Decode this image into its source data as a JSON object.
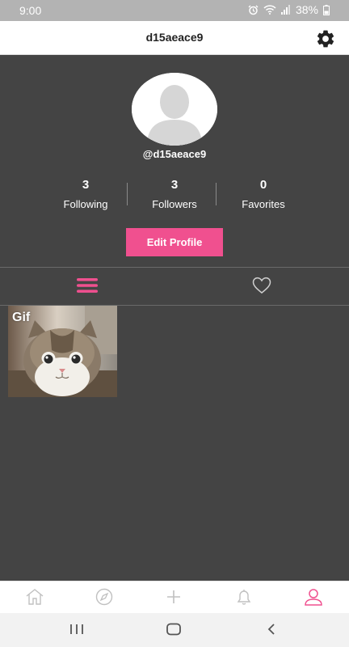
{
  "status_bar": {
    "time": "9:00",
    "battery": "38%",
    "icons": [
      "alarm-icon",
      "wifi-icon",
      "signal-icon",
      "battery-icon"
    ]
  },
  "header": {
    "title": "d15aeace9",
    "settings_icon": "gear-icon"
  },
  "profile": {
    "username": "@d15aeace9",
    "stats": [
      {
        "count": "3",
        "label": "Following"
      },
      {
        "count": "3",
        "label": "Followers"
      },
      {
        "count": "0",
        "label": "Favorites"
      }
    ],
    "edit_button_label": "Edit Profile"
  },
  "tabs": [
    {
      "icon": "menu-lines-icon",
      "active": true
    },
    {
      "icon": "heart-icon",
      "active": false
    }
  ],
  "posts": [
    {
      "label": "Gif",
      "thumbnail": "cat-thumbnail"
    }
  ],
  "bottom_nav": [
    {
      "icon": "home-icon",
      "active": false
    },
    {
      "icon": "compass-icon",
      "active": false
    },
    {
      "icon": "plus-icon",
      "active": false
    },
    {
      "icon": "bell-icon",
      "active": false
    },
    {
      "icon": "profile-icon",
      "active": true
    }
  ],
  "system_nav": [
    "recent-apps-icon",
    "home-button-icon",
    "back-icon"
  ],
  "colors": {
    "accent": "#f0508f",
    "background": "#444444",
    "status_bar": "#b3b3b3",
    "nav_inactive": "#c0c0c0"
  }
}
